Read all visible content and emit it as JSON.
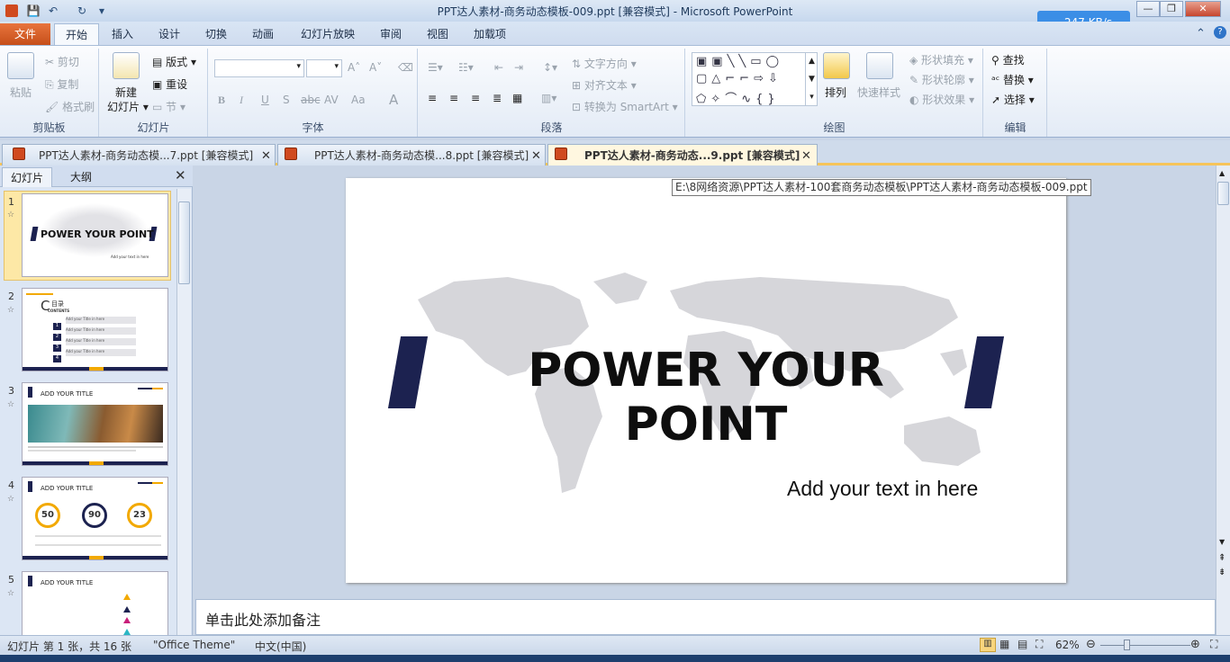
{
  "window": {
    "title": "PPT达人素材-商务动态模板-009.ppt [兼容模式]  -  Microsoft PowerPoint",
    "speed": "247 KB/s"
  },
  "tabs": [
    "文件",
    "开始",
    "插入",
    "设计",
    "切换",
    "动画",
    "幻灯片放映",
    "审阅",
    "视图",
    "加载项"
  ],
  "ribbon": {
    "clipboard": {
      "paste": "粘贴",
      "cut": "剪切",
      "copy": "复制",
      "format_painter": "格式刷",
      "label": "剪贴板"
    },
    "slides": {
      "new_slide_line1": "新建",
      "new_slide_line2": "幻灯片",
      "layout": "版式",
      "reset": "重设",
      "section": "节",
      "label": "幻灯片"
    },
    "font": {
      "bold": "B",
      "italic": "I",
      "underline": "U",
      "shadow": "S",
      "strike": "abc",
      "spacing": "AV",
      "case": "Aa",
      "color": "A",
      "label": "字体"
    },
    "paragraph": {
      "text_direction": "文字方向",
      "align_text": "对齐文本",
      "smartart": "转换为 SmartArt",
      "label": "段落"
    },
    "drawing": {
      "arrange": "排列",
      "quick_styles": "快速样式",
      "shape_fill": "形状填充",
      "shape_outline": "形状轮廓",
      "shape_effects": "形状效果",
      "label": "绘图"
    },
    "editing": {
      "find": "查找",
      "replace": "替换",
      "select": "选择",
      "label": "编辑"
    }
  },
  "doc_tabs": [
    {
      "label": "PPT达人素材-商务动态模...7.ppt [兼容模式]"
    },
    {
      "label": "PPT达人素材-商务动态模...8.ppt [兼容模式]"
    },
    {
      "label": "PPT达人素材-商务动态...9.ppt [兼容模式]"
    }
  ],
  "left_pane": {
    "tab_slides": "幻灯片",
    "tab_outline": "大纲",
    "thumbs": [
      {
        "num": "1",
        "title": "POWER YOUR POINT",
        "sub": "Add your text in here"
      },
      {
        "num": "2",
        "title": "目录",
        "sub": "CONTENTS",
        "item": "Add your Title in here",
        "items": [
          "1",
          "2",
          "3",
          "4"
        ]
      },
      {
        "num": "3",
        "title": "ADD YOUR TITLE"
      },
      {
        "num": "4",
        "title": "ADD YOUR TITLE",
        "stats": [
          "50",
          "90",
          "23"
        ]
      },
      {
        "num": "5",
        "title": "ADD YOUR TITLE"
      }
    ]
  },
  "slide": {
    "title": "POWER YOUR POINT",
    "subtitle": "Add your text in here"
  },
  "tooltip": "E:\\8网络资源\\PPT达人素材-100套商务动态模板\\PPT达人素材-商务动态模板-009.ppt",
  "notes_placeholder": "单击此处添加备注",
  "status": {
    "slide_info": "幻灯片 第 1 张，共 16 张",
    "theme": "\"Office Theme\"",
    "lang": "中文(中国)",
    "zoom": "62%"
  },
  "colors": {
    "navy": "#1c2250",
    "accent": "#f2a900",
    "file_tab": "#d65b25"
  }
}
